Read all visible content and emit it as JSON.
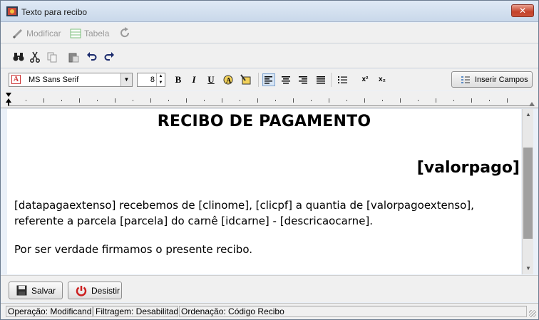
{
  "window": {
    "title": "Texto para recibo",
    "close_label": "✕"
  },
  "toolbar1": {
    "modificar_label": "Modificar",
    "tabela_label": "Tabela"
  },
  "format": {
    "font_name": "MS Sans Serif",
    "font_size": "8",
    "bold": "B",
    "italic": "I",
    "underline": "U",
    "superscript": "x²",
    "subscript": "x₂",
    "insert_fields_label": "Inserir Campos"
  },
  "document": {
    "title": "RECIBO DE PAGAMENTO",
    "amount_field": "[valorpago]",
    "paragraph1": "[datapagaextenso] recebemos de [clinome],  [clicpf] a quantia de [valorpagoextenso], referente a parcela [parcela] do carnê [idcarne] - [descricaocarne].",
    "paragraph2": "Por ser verdade firmamos o presente recibo."
  },
  "buttons": {
    "save_label": "Salvar",
    "cancel_label": "Desistir"
  },
  "status": {
    "operacao": "Operação: Modificand",
    "filtragem": "Filtragem: Desabilitad",
    "ordenacao": "Ordenação: Código Recibo"
  },
  "icons": [
    "app-icon",
    "pencil-icon",
    "table-icon",
    "refresh-icon",
    "binoculars-icon",
    "cut-icon",
    "copy-icon",
    "paste-icon",
    "undo-icon",
    "redo-icon",
    "font-color-icon",
    "highlight-icon",
    "align-left-icon",
    "align-center-icon",
    "align-right-icon",
    "justify-icon",
    "bullets-icon",
    "save-icon",
    "cancel-icon"
  ]
}
